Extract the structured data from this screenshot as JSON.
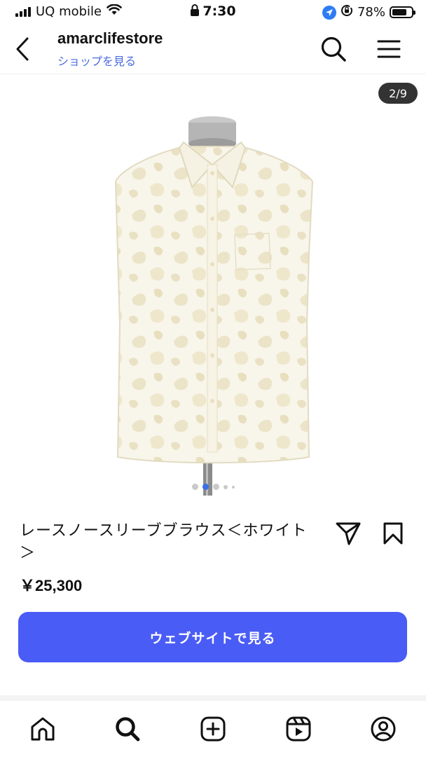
{
  "status_bar": {
    "carrier": "UQ mobile",
    "time": "7:30",
    "battery_percent": "78%",
    "battery_level": 0.78,
    "icons": [
      "signal-icon",
      "wifi-icon",
      "lock-icon",
      "location-icon",
      "orientation-lock-icon",
      "battery-icon"
    ]
  },
  "header": {
    "store_name": "amarclifestore",
    "shop_link": "ショップを見る",
    "icons": [
      "back-icon",
      "search-icon",
      "menu-icon"
    ]
  },
  "gallery": {
    "page_indicator": "2/9",
    "current_index": 2,
    "total": 9,
    "image_description": "sleeveless-white-lace-blouse-on-mannequin"
  },
  "product": {
    "title": "レースノースリーブブラウス＜ホワイト＞",
    "price": "￥25,300",
    "cta_label": "ウェブサイトで見る",
    "icons": [
      "share-icon",
      "bookmark-icon"
    ]
  },
  "bottom_nav": {
    "items": [
      "home-icon",
      "search-icon",
      "create-icon",
      "reels-icon",
      "profile-icon"
    ]
  },
  "colors": {
    "accent": "#4a5cf6",
    "link": "#4a6be0",
    "badge_bg": "#333333"
  }
}
